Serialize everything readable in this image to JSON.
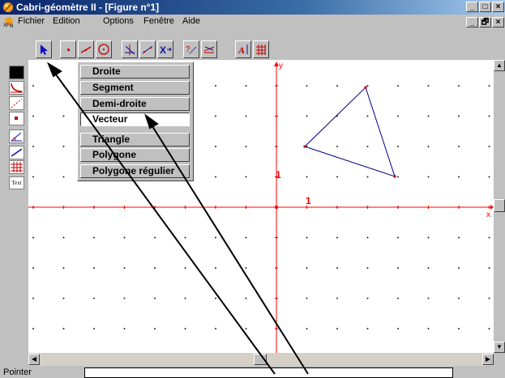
{
  "window": {
    "title": "Cabri-géomètre II - [Figure n°1]",
    "app_icon": "cabri-logo-icon",
    "controls": [
      "_",
      "□",
      "×"
    ],
    "doc_controls": [
      "_",
      "🗗",
      "×"
    ]
  },
  "menubar": {
    "doc_icon": "figure-document-icon",
    "items": [
      "Fichier",
      "Edition",
      "Options",
      "Fenêtre",
      "Aide"
    ]
  },
  "toolbar": {
    "tools": [
      "pointer-arrow-icon",
      "point-icon",
      "line-icon",
      "circle-icon",
      "construct-icon",
      "transform-icon",
      "macro-icon",
      "check-property-icon",
      "measure-icon",
      "display-text-icon",
      "draw-grid-icon"
    ]
  },
  "palette": {
    "items": [
      "color-fill-icon",
      "curve-style-icon",
      "dotted-style-icon",
      "point-style-icon",
      "angle-mark-icon",
      "line-thickness-icon",
      "grid-icon"
    ],
    "text_label": "Text"
  },
  "dropdown": {
    "items": [
      "Droite",
      "Segment",
      "Demi-droite",
      "Vecteur",
      "Triangle",
      "Polygone",
      "Polygone régulier"
    ],
    "selected_index": 3
  },
  "canvas": {
    "axis_y_label": "y",
    "axis_x_label": "x",
    "unit_y_label": "1",
    "unit_x_label": "1",
    "accent": "#ff0000",
    "triangle_color": "#000080"
  },
  "status": {
    "text": "Pointer"
  }
}
